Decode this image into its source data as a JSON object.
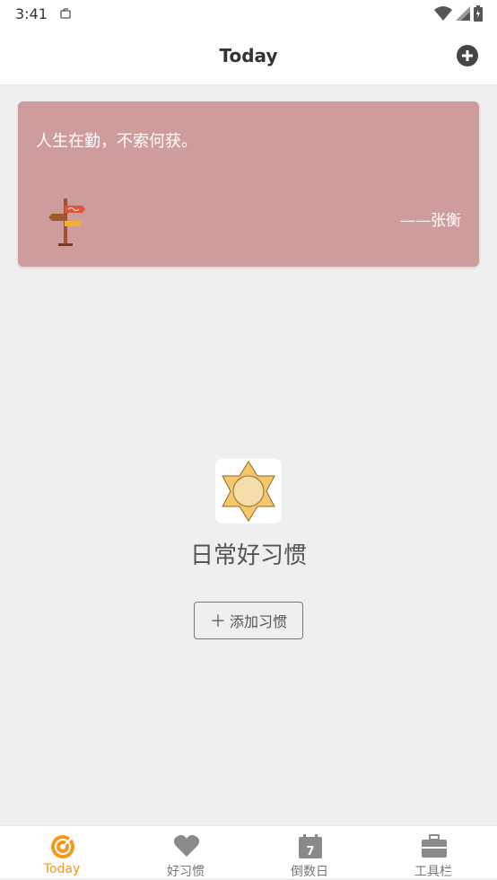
{
  "status_bar": {
    "time": "3:41",
    "icons": [
      "notification-icon",
      "wifi-icon",
      "signal-icon",
      "battery-icon"
    ]
  },
  "app_bar": {
    "title": "Today",
    "action_icon": "add-circle-icon"
  },
  "quote_card": {
    "text": "人生在勤，不索何获。",
    "author": "——张衡",
    "background": "#cf9c9d",
    "icon": "signpost-icon"
  },
  "empty_state": {
    "icon": "sun-icon",
    "title": "日常好习惯",
    "button_label": "添加习惯",
    "button_icon": "plus-icon"
  },
  "bottom_nav": {
    "items": [
      {
        "label": "Today",
        "icon": "today-icon",
        "active": true
      },
      {
        "label": "好习惯",
        "icon": "heart-icon",
        "active": false
      },
      {
        "label": "倒数日",
        "icon": "calendar-icon",
        "active": false
      },
      {
        "label": "工具栏",
        "icon": "toolbox-icon",
        "active": false
      }
    ],
    "active_color": "#f19a19",
    "inactive_color": "#777777"
  }
}
